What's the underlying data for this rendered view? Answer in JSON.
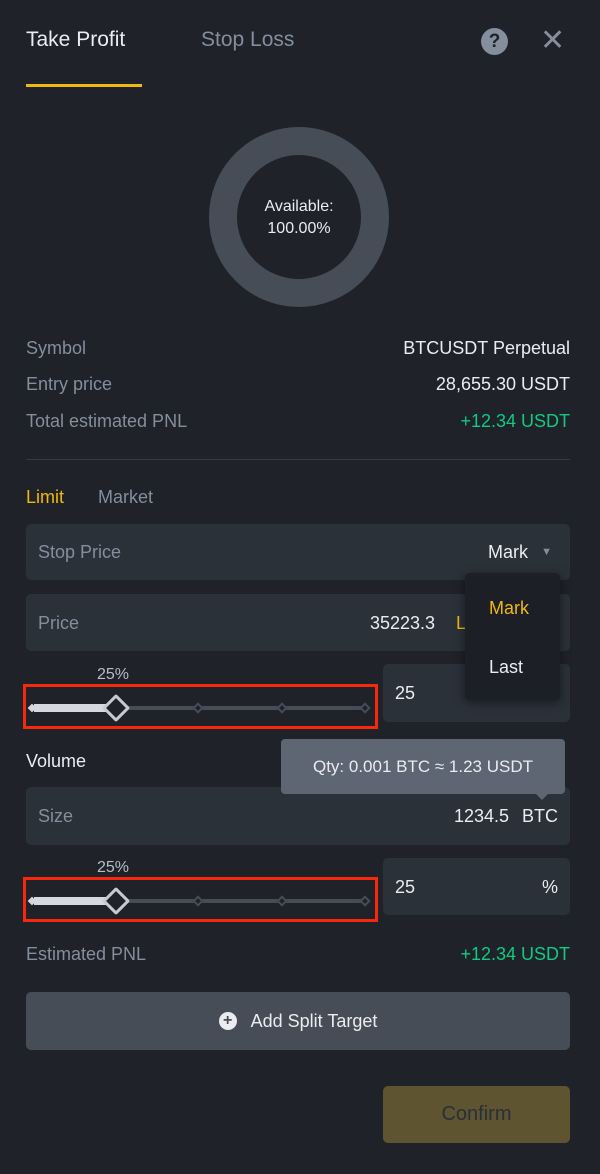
{
  "tabs": [
    {
      "label": "Take Profit",
      "active": true
    },
    {
      "label": "Stop Loss",
      "active": false
    }
  ],
  "icons": {
    "help": "question-circle-icon",
    "close": "close-icon"
  },
  "donut": {
    "label": "Available:",
    "value": "100.00%",
    "available_fraction": 1.0
  },
  "info": {
    "symbol_label": "Symbol",
    "symbol_value": "BTCUSDT Perpetual",
    "entry_label": "Entry price",
    "entry_value": "28,655.30 USDT",
    "pnl_label": "Total estimated PNL",
    "pnl_value": "+12.34 USDT"
  },
  "order_types": {
    "limit": "Limit",
    "market": "Market"
  },
  "stop_price": {
    "label": "Stop Price",
    "trigger": "Mark"
  },
  "price": {
    "label": "Price",
    "value": "35223.3",
    "unit": "Last"
  },
  "dropdown": {
    "options": [
      "Mark",
      "Last"
    ],
    "selected": "Mark"
  },
  "slider1": {
    "label": "25%",
    "value": 25,
    "input": "25"
  },
  "volume": {
    "label": "Volume",
    "tooltip": "Qty: 0.001 BTC ≈ 1.23 USDT",
    "size_label": "Size",
    "size_value": "1234.5",
    "size_unit": "BTC"
  },
  "slider2": {
    "label": "25%",
    "value": 25,
    "input": "25",
    "unit": "%"
  },
  "estimated": {
    "label": "Estimated PNL",
    "value": "+12.34 USDT"
  },
  "add_split": "Add Split Target",
  "confirm": "Confirm",
  "colors": {
    "accent": "#f0b90b",
    "positive": "#0ecb81",
    "background": "#1f2229",
    "field": "#2b3139"
  }
}
